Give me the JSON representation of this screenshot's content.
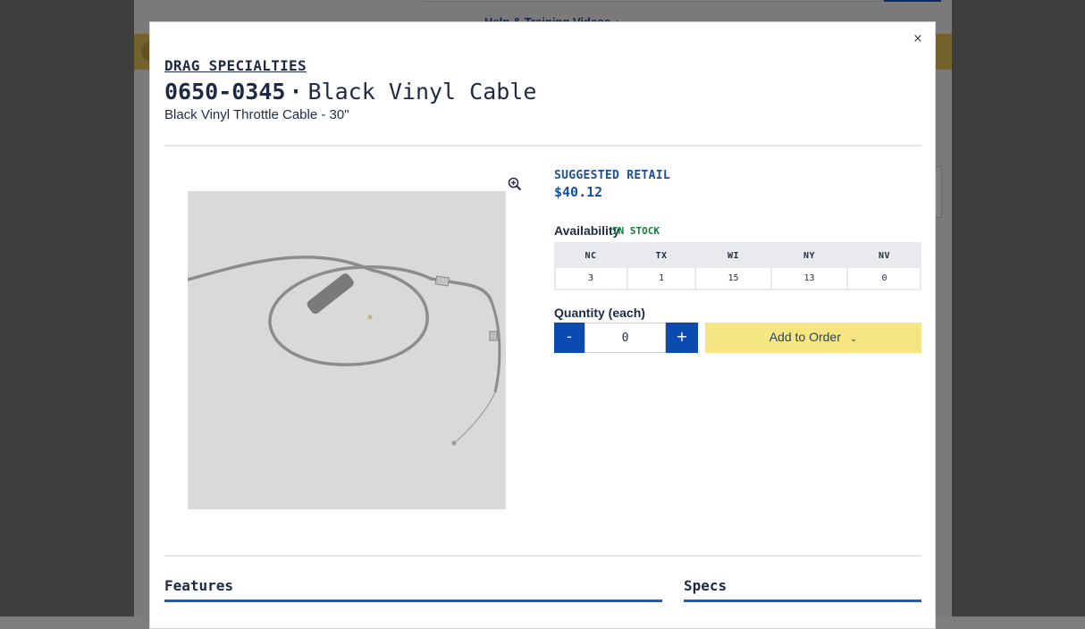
{
  "background": {
    "help_link": "Help & Training Videos",
    "help_chevron": "›"
  },
  "modal": {
    "close_label": "×",
    "brand": "DRAG SPECIALTIES",
    "part_number": "0650-0345",
    "separator": "·",
    "title_name": "Black Vinyl Cable",
    "subtitle": "Black Vinyl Throttle Cable - 30\"",
    "zoom_icon": "zoom-in-icon",
    "suggested_retail_label": "SUGGESTED RETAIL",
    "suggested_retail_price": "$40.12",
    "availability_label": "Availability",
    "availability_status": "IN STOCK",
    "warehouses": [
      {
        "code": "NC",
        "qty": "3"
      },
      {
        "code": "TX",
        "qty": "1"
      },
      {
        "code": "WI",
        "qty": "15"
      },
      {
        "code": "NY",
        "qty": "13"
      },
      {
        "code": "NV",
        "qty": "0"
      }
    ],
    "quantity_label": "Quantity (each)",
    "quantity_value": "0",
    "minus_label": "-",
    "plus_label": "+",
    "add_to_order_label": "Add to Order",
    "add_to_order_caret": "⌄",
    "features_heading": "Features",
    "specs_heading": "Specs",
    "colors": {
      "primary_blue": "#0b4bb0",
      "add_button": "#f6e681",
      "in_stock": "#1a7a3c",
      "banner": "#e8c55b"
    }
  }
}
